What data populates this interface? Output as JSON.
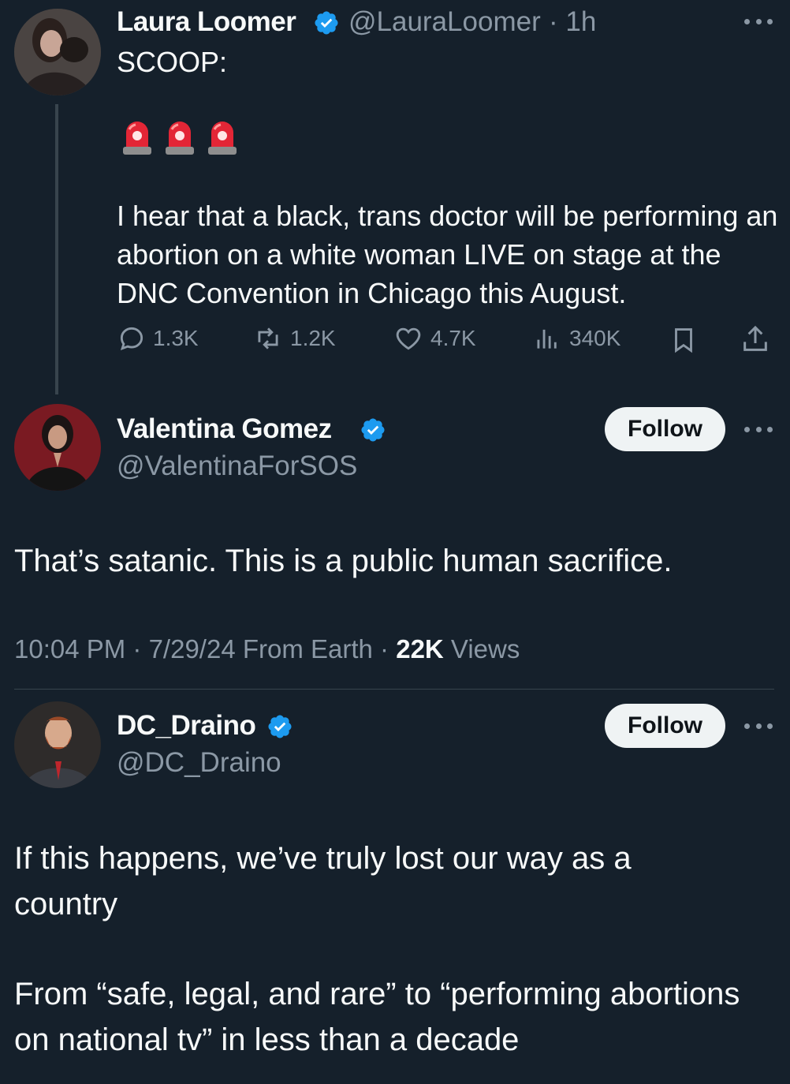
{
  "tweet1": {
    "name": "Laura Loomer",
    "handle": "@LauraLoomer",
    "time": "· 1h",
    "line1": "SCOOP:",
    "body": "I hear that a black, trans doctor will be performing an abortion on a white woman LIVE on stage at the DNC Convention in Chicago this August.",
    "replies": "1.3K",
    "reposts": "1.2K",
    "likes": "4.7K",
    "views": "340K"
  },
  "tweet2": {
    "name": "Valentina Gomez",
    "handle": "@ValentinaForSOS",
    "follow": "Follow",
    "body": "That’s satanic. This is a public human sacrifice.",
    "timestamp": "10:04 PM · 7/29/24 From Earth · ",
    "views_count": "22K",
    "views_label": " Views"
  },
  "tweet3": {
    "name": "DC_Draino",
    "handle": "@DC_Draino",
    "follow": "Follow",
    "para1": "If this happens, we’ve truly lost our way as a country",
    "para2": "From “safe, legal, and rare” to “performing abortions on national tv” in less than a decade"
  },
  "colors": {
    "background": "#15202b",
    "text": "#f7f9f9",
    "muted": "#8b98a5",
    "verified": "#1d9bf0",
    "divider": "#38444d"
  }
}
